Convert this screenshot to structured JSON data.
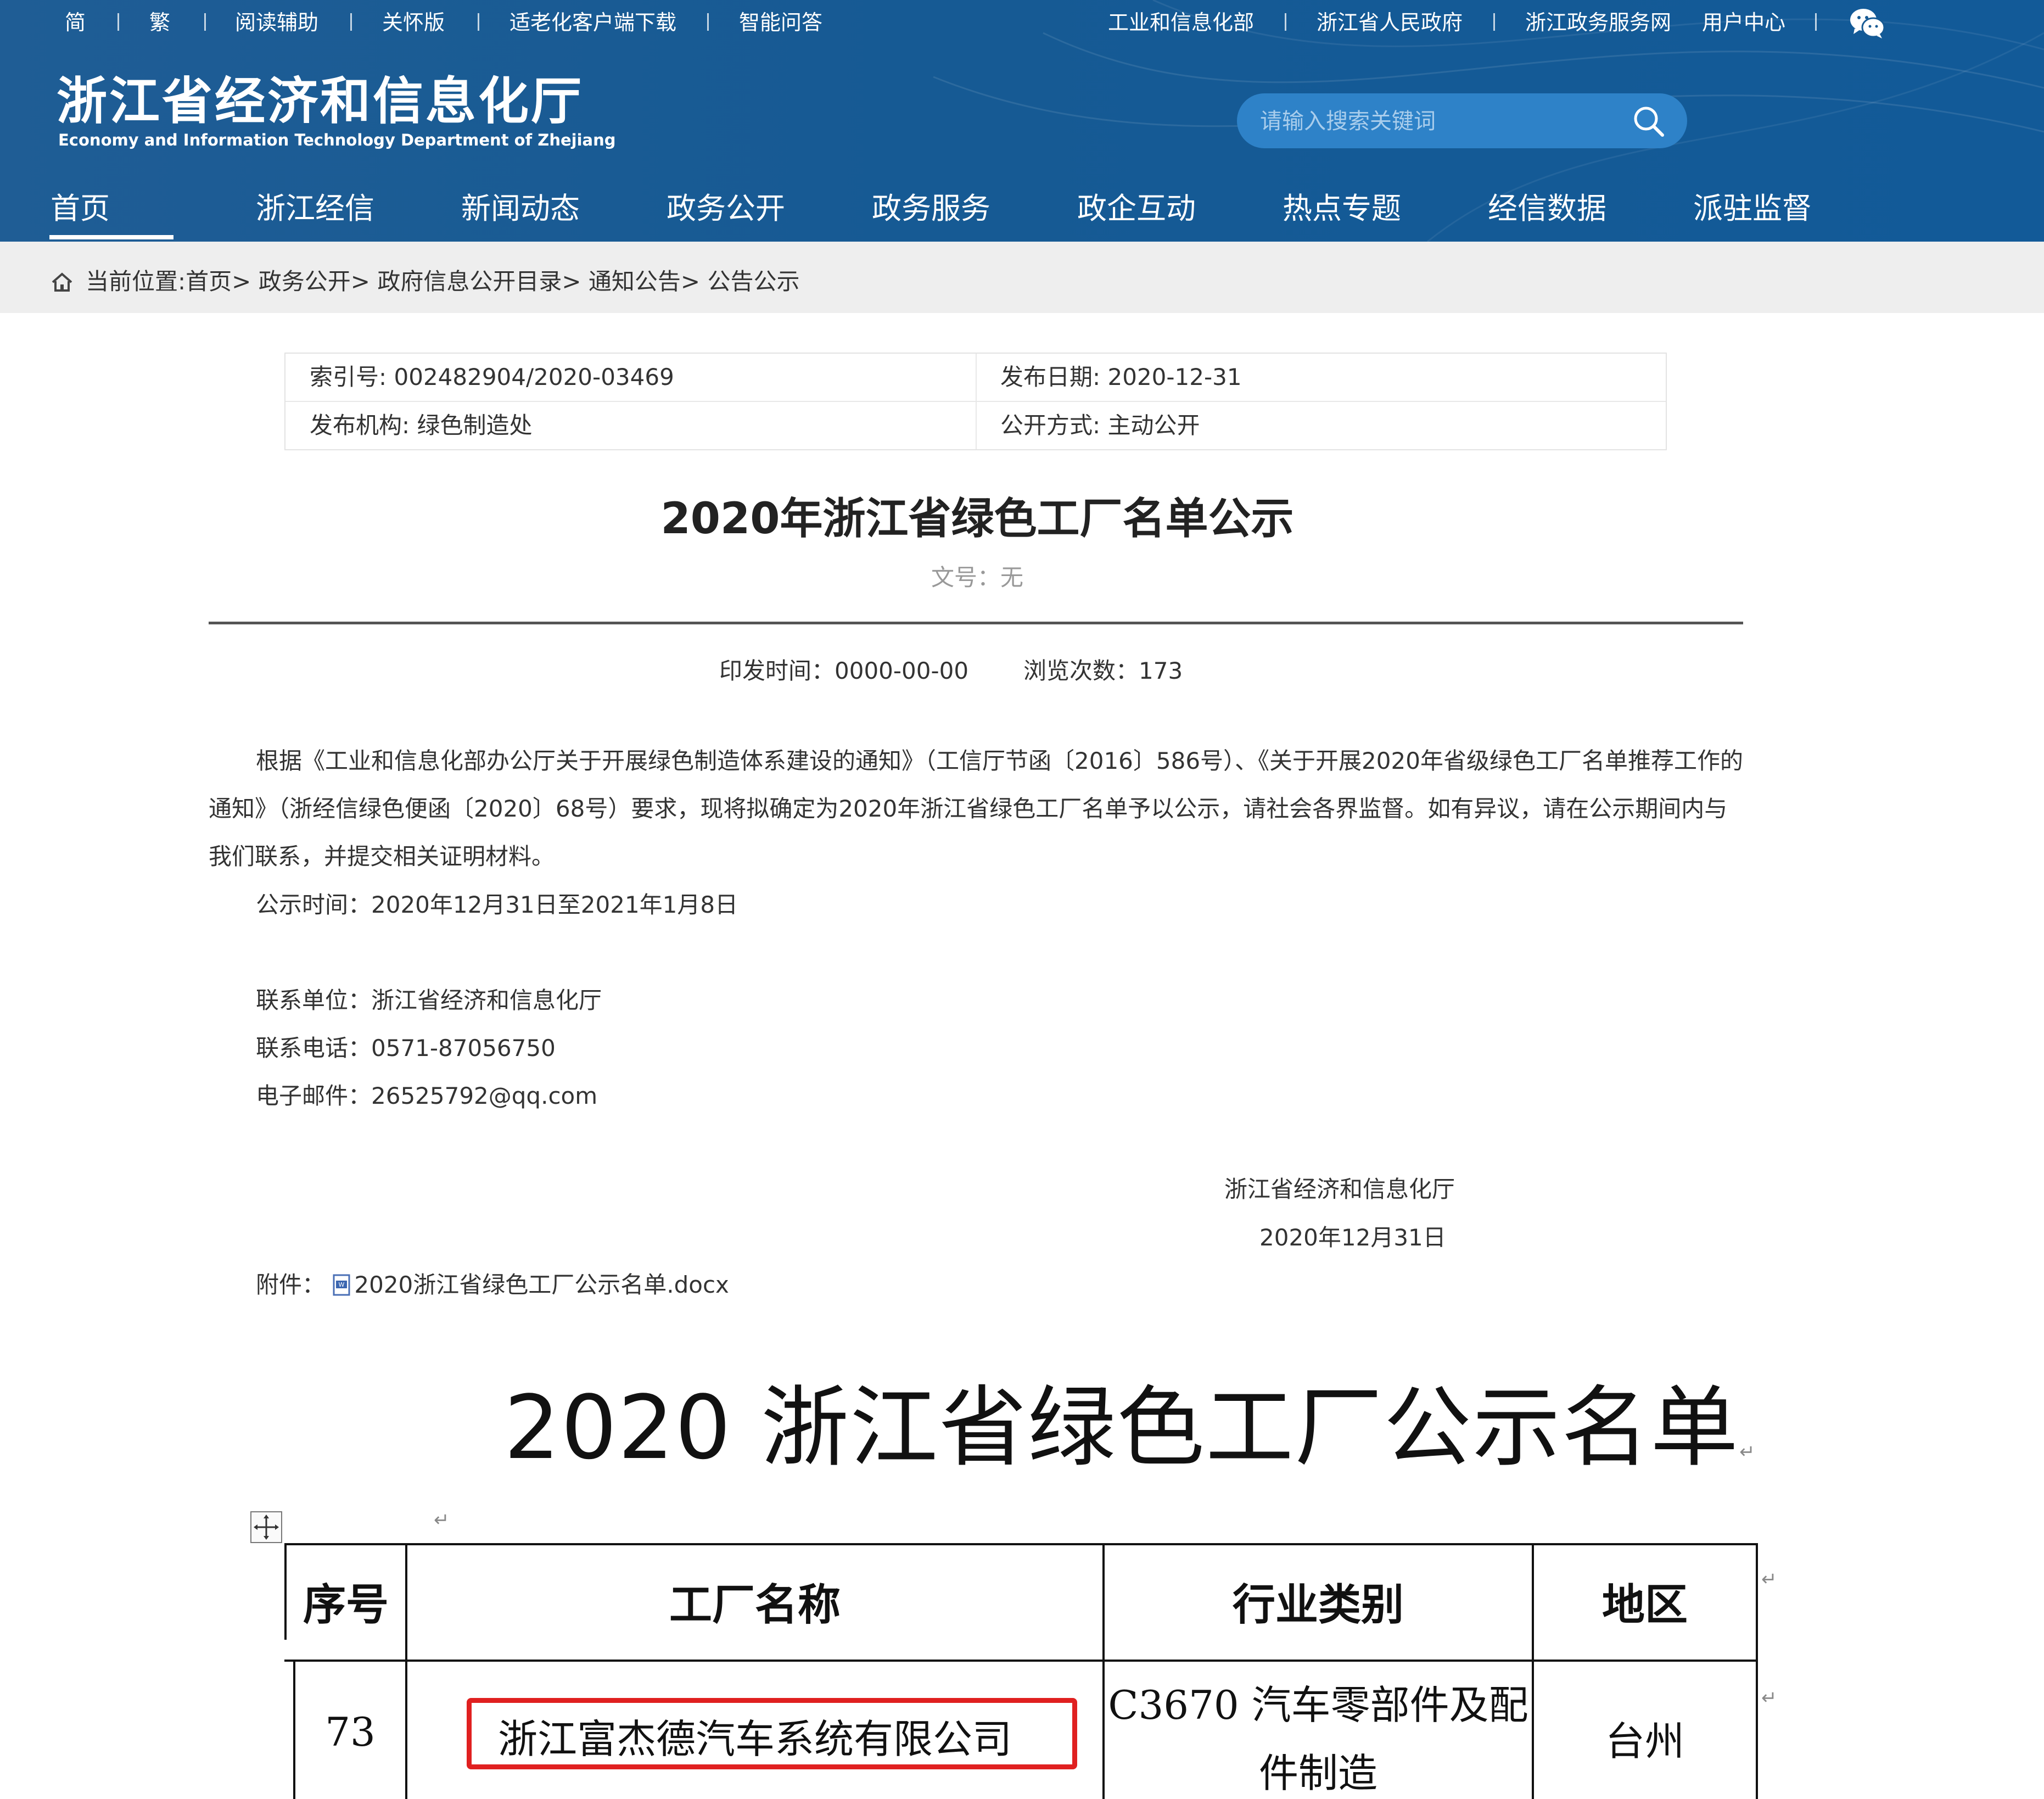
{
  "topbar": {
    "left_links": [
      "简",
      "繁",
      "阅读辅助",
      "关怀版",
      "适老化客户端下载",
      "智能问答"
    ],
    "right_links": [
      "工业和信息化部",
      "浙江省人民政府",
      "浙江政务服务网",
      "用户中心"
    ],
    "wechat_icon": "wechat-icon"
  },
  "site": {
    "title": "浙江省经济和信息化厅",
    "subtitle": "Economy and Information Technology Department of Zhejiang"
  },
  "search": {
    "placeholder": "请输入搜索关键词",
    "icon": "search-icon"
  },
  "nav": {
    "items": [
      "首页",
      "浙江经信",
      "新闻动态",
      "政务公开",
      "政务服务",
      "政企互动",
      "热点专题",
      "经信数据",
      "派驻监督"
    ],
    "active": "首页"
  },
  "breadcrumb": {
    "prefix": "当前位置:",
    "items": [
      "首页",
      "政务公开",
      "政府信息公开目录",
      "通知公告",
      "公告公示"
    ],
    "separator": ">"
  },
  "meta": {
    "index_no": "索引号: 002482904/2020-03469",
    "publish_date": "发布日期: 2020-12-31",
    "publisher": "发布机构: 绿色制造处",
    "disclosure": "公开方式: 主动公开"
  },
  "article": {
    "title": "2020年浙江省绿色工厂名单公示",
    "doc_no": "文号：无",
    "print_time": "印发时间：0000-00-00",
    "views": "浏览次数：173",
    "body": "根据《工业和信息化部办公厅关于开展绿色制造体系建设的通知》（工信厅节函〔2016〕586号）、《关于开展2020年省级绿色工厂名单推荐工作的通知》（浙经信绿色便函〔2020〕68号）要求，现将拟确定为2020年浙江省绿色工厂名单予以公示，请社会各界监督。如有异议，请在公示期间内与我们联系，并提交相关证明材料。",
    "notice_period": "公示时间：2020年12月31日至2021年1月8日",
    "contact_unit": "联系单位：浙江省经济和信息化厅",
    "contact_phone": "联系电话：0571-87056750",
    "contact_email": "电子邮件：26525792@qq.com",
    "sign_org": "浙江省经济和信息化厅",
    "sign_date": "2020年12月31日",
    "attachment_label": "附件：",
    "attachment_file": "2020浙江省绿色工厂公示名单.docx"
  },
  "document": {
    "heading": "2020 浙江省绿色工厂公示名单",
    "para_mark": "↵",
    "columns": [
      "序号",
      "工厂名称",
      "行业类别",
      "地区"
    ],
    "rows": [
      {
        "no": "73",
        "name": "浙江富杰德汽车系统有限公司",
        "industry_line1": "C3670  汽车零部件及配",
        "industry_line2": "件制造",
        "region": "台州",
        "highlighted": true
      }
    ]
  },
  "colors": {
    "header_blue": "#165a94",
    "search_bg": "#2e82c8",
    "breadcrumb_bg": "#eeeeee",
    "highlight_red": "#e02020"
  }
}
